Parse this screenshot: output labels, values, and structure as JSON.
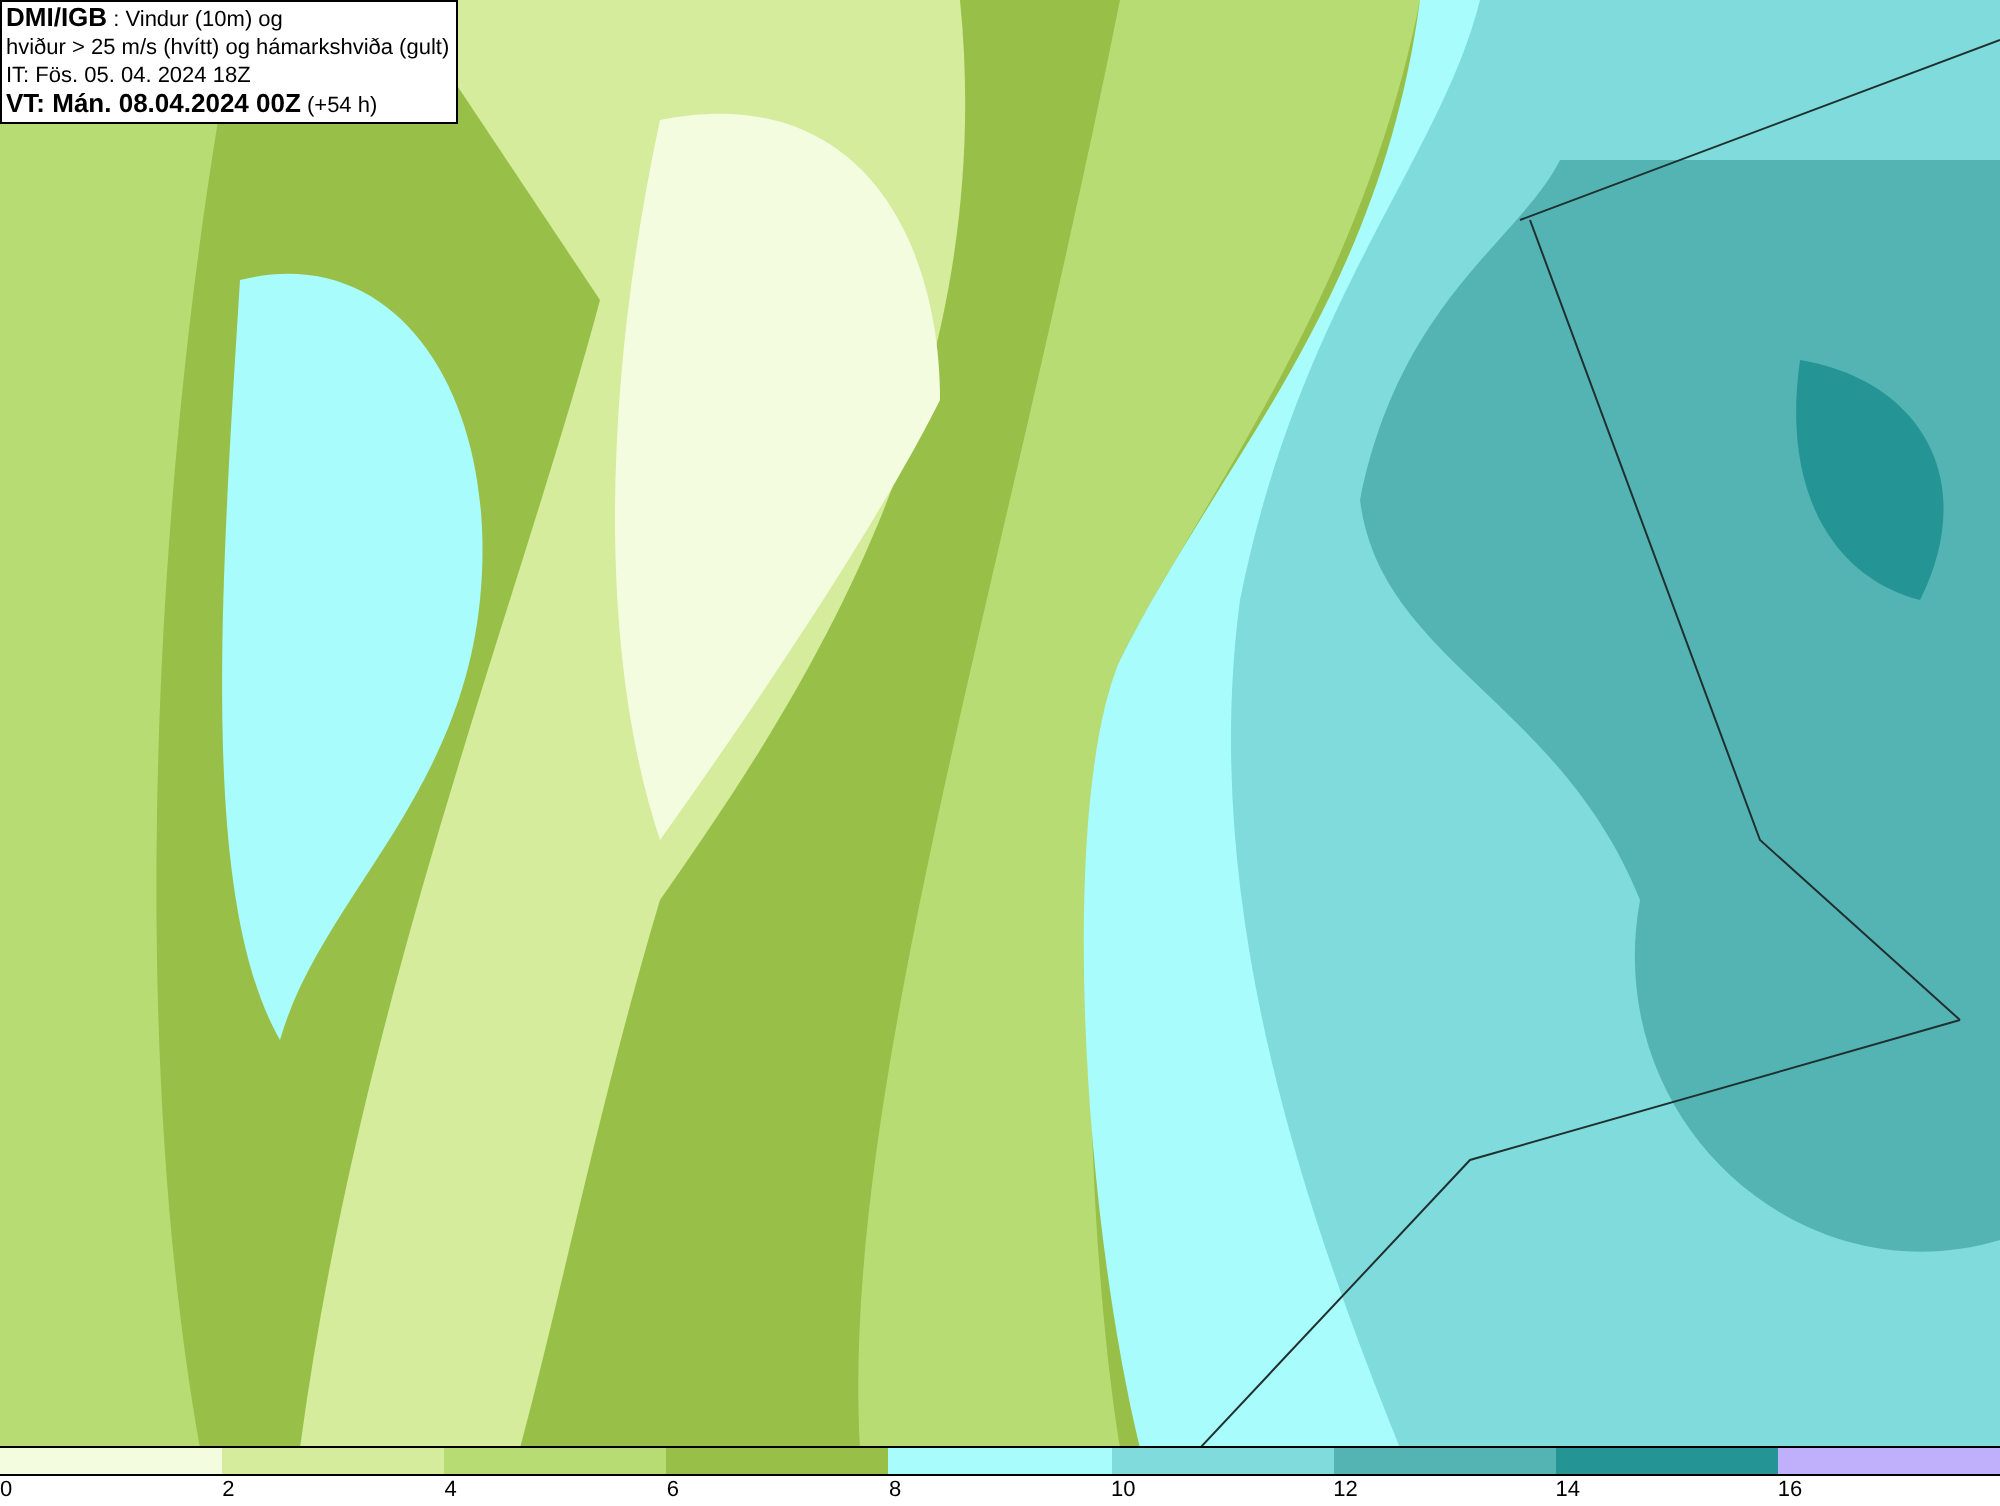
{
  "title_box": {
    "lines": [
      "**DMI/IGB** : Vindur (10m) og",
      "hviður > 25 m/s (hvítt) og hámarkshviða (gult)",
      "IT: Fös. 05. 04. 2024 18Z",
      "**VT: Mán. 08.04.2024 00Z** (+54 h)"
    ]
  },
  "legend": {
    "swatches": [
      {
        "color": "#f4fce0"
      },
      {
        "color": "#d4ec9c"
      },
      {
        "color": "#b8dc74"
      },
      {
        "color": "#98c048"
      },
      {
        "color": "#a8fcfc"
      },
      {
        "color": "#80dcdc"
      },
      {
        "color": "#54b4b4"
      },
      {
        "color": "#249494"
      },
      {
        "color": "#c0b0fc"
      }
    ],
    "ticks": [
      "0",
      "2",
      "4",
      "6",
      "8",
      "10",
      "12",
      "14",
      "16"
    ]
  }
}
